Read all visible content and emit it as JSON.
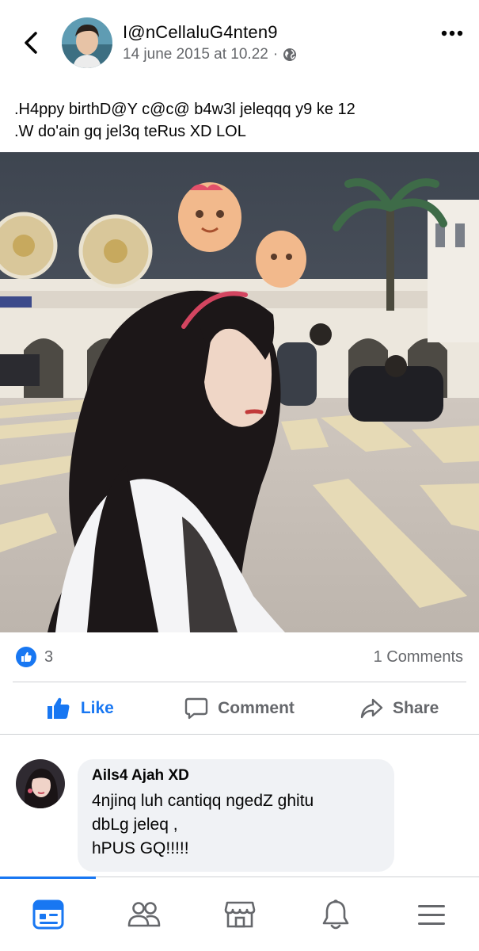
{
  "post": {
    "author": "I@nCellaluG4nten9",
    "timestamp": "14 june 2015 at 10.22",
    "separator": "·",
    "privacy_icon": "globe-icon",
    "text_lines": [
      ".H4ppy birthD@Y c@c@ b4w3l jeleqqq y9 ke 12",
      ".W do'ain gq jel3q teRus XD LOL"
    ]
  },
  "stats": {
    "like_count": "3",
    "comments_label": "1 Comments"
  },
  "actions": {
    "like_label": "Like",
    "comment_label": "Comment",
    "share_label": "Share"
  },
  "comment": {
    "author": "Ails4 Ajah XD",
    "lines": [
      "4njinq luh cantiqq ngedZ ghitu",
      "dbLg jeleq ,",
      "hPUS GQ!!!!!"
    ]
  },
  "tabs": [
    {
      "icon": "news-feed-icon",
      "active": true
    },
    {
      "icon": "friends-icon",
      "active": false
    },
    {
      "icon": "marketplace-icon",
      "active": false
    },
    {
      "icon": "notifications-bell-icon",
      "active": false
    },
    {
      "icon": "menu-icon",
      "active": false
    }
  ],
  "colors": {
    "accent": "#1877f2",
    "secondary_text": "#65676b",
    "bubble_bg": "#f0f2f5",
    "divider": "#ced0d4"
  }
}
